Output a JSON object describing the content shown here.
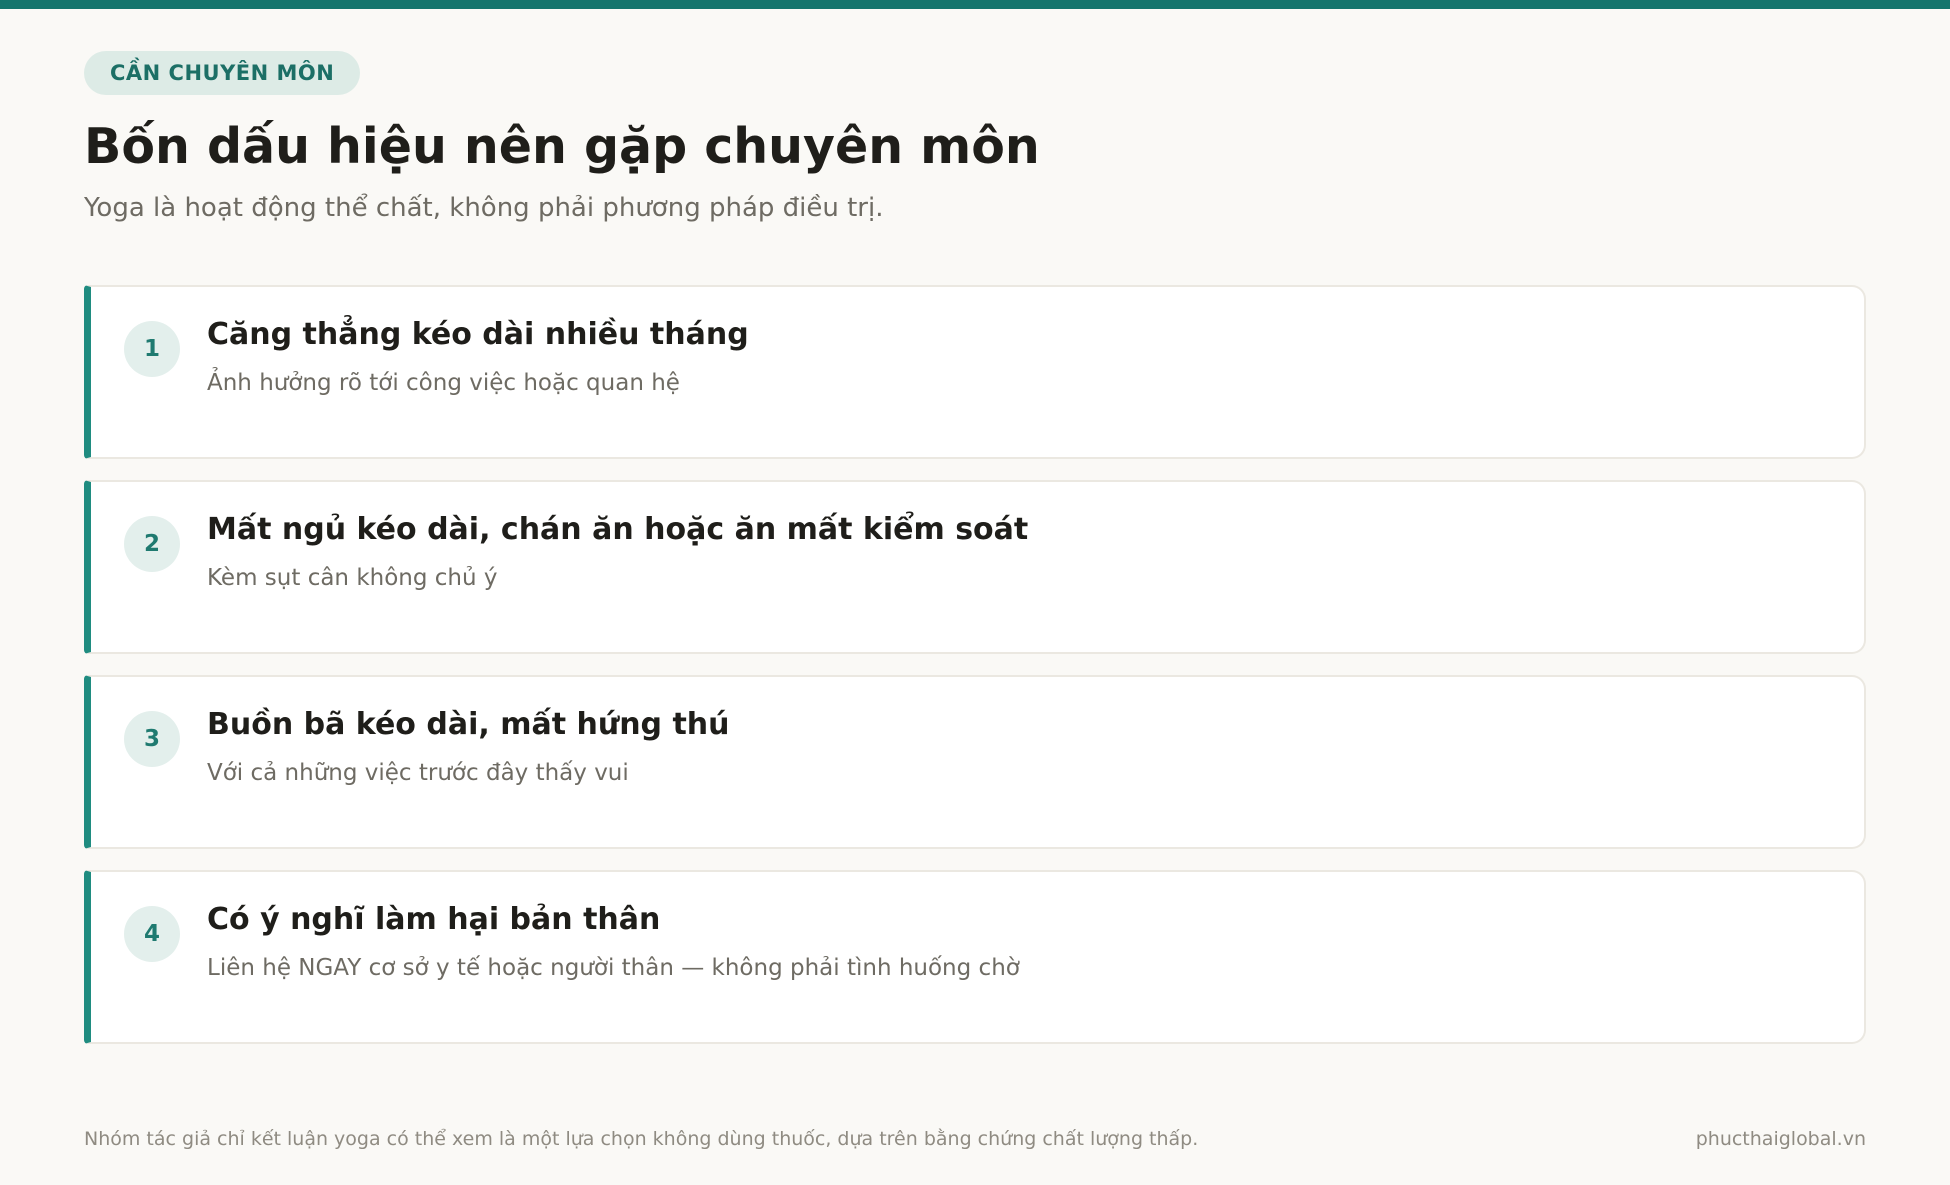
{
  "header": {
    "tag": "CẦN CHUYÊN MÔN",
    "title": "Bốn dấu hiệu nên gặp chuyên môn",
    "subtitle": "Yoga là hoạt động thể chất, không phải phương pháp điều trị."
  },
  "items": [
    {
      "number": "1",
      "title": "Căng thẳng kéo dài nhiều tháng",
      "description": "Ảnh hưởng rõ tới công việc hoặc quan hệ"
    },
    {
      "number": "2",
      "title": "Mất ngủ kéo dài, chán ăn hoặc ăn mất kiểm soát",
      "description": "Kèm sụt cân không chủ ý"
    },
    {
      "number": "3",
      "title": "Buồn bã kéo dài, mất hứng thú",
      "description": "Với cả những việc trước đây thấy vui"
    },
    {
      "number": "4",
      "title": "Có ý nghĩ làm hại bản thân",
      "description": "Liên hệ NGAY cơ sở y tế hoặc người thân — không phải tình huống chờ"
    }
  ],
  "footer": {
    "note": "Nhóm tác giả chỉ kết luận yoga có thể xem là một lựa chọn không dùng thuốc, dựa trên bằng chứng chất lượng thấp.",
    "site": "phucthaiglobal.vn"
  },
  "colors": {
    "accent": "#15756d",
    "background": "#faf9f6"
  }
}
